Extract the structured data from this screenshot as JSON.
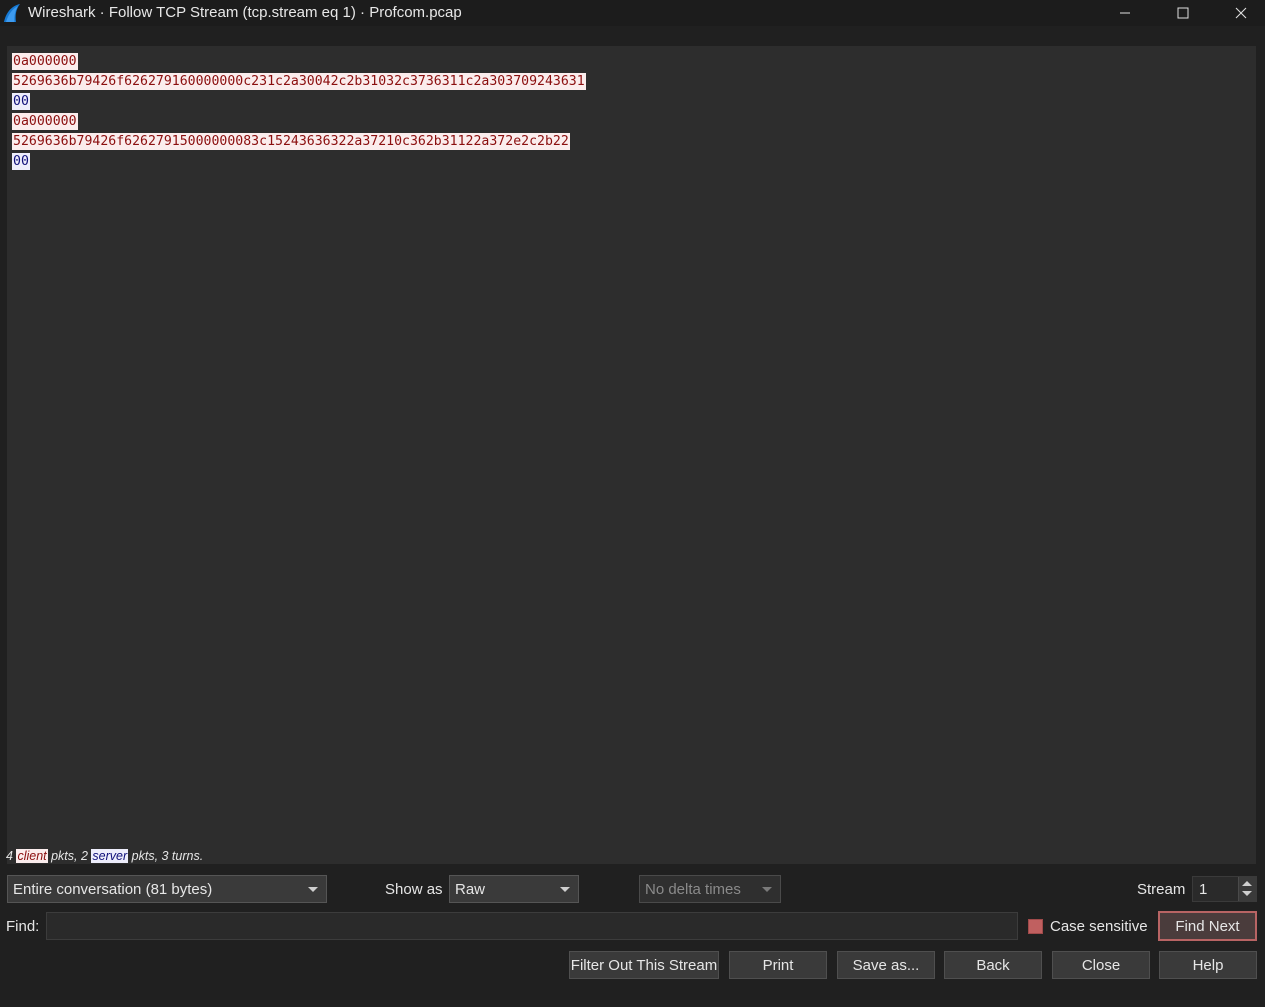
{
  "window": {
    "title": "Wireshark · Follow TCP Stream (tcp.stream eq 1) · Profcom.pcap"
  },
  "stream_lines": [
    {
      "text": "0a000000",
      "side": "client"
    },
    {
      "text": "5269636b79426f626279160000000c231c2a30042c2b31032c3736311c2a303709243631",
      "side": "client"
    },
    {
      "text": "00",
      "side": "server"
    },
    {
      "text": "0a000000",
      "side": "client"
    },
    {
      "text": "5269636b79426f62627915000000083c15243636322a37210c362b31122a372e2c2b22",
      "side": "client"
    },
    {
      "text": "00",
      "side": "server"
    }
  ],
  "stats": {
    "client_count": "4",
    "client_word": "client",
    "mid": "pkts, 2",
    "server_word": "server",
    "tail": "pkts, 3 turns."
  },
  "controls": {
    "conversation_value": "Entire conversation (81 bytes)",
    "show_as_label": "Show as",
    "show_as_value": "Raw",
    "delta_value": "No delta times",
    "stream_label": "Stream",
    "stream_value": "1",
    "find_label": "Find:",
    "find_value": "",
    "case_sensitive_label": "Case sensitive",
    "find_next_label": "Find Next"
  },
  "buttons": {
    "filter_out": "Filter Out This Stream",
    "print": "Print",
    "save_as": "Save as...",
    "back": "Back",
    "close": "Close",
    "help": "Help"
  },
  "colors": {
    "client_bg": "#fbeded",
    "client_fg": "#8b0f0f",
    "server_bg": "#ededfb",
    "server_fg": "#10107a",
    "accent": "#b86464"
  }
}
